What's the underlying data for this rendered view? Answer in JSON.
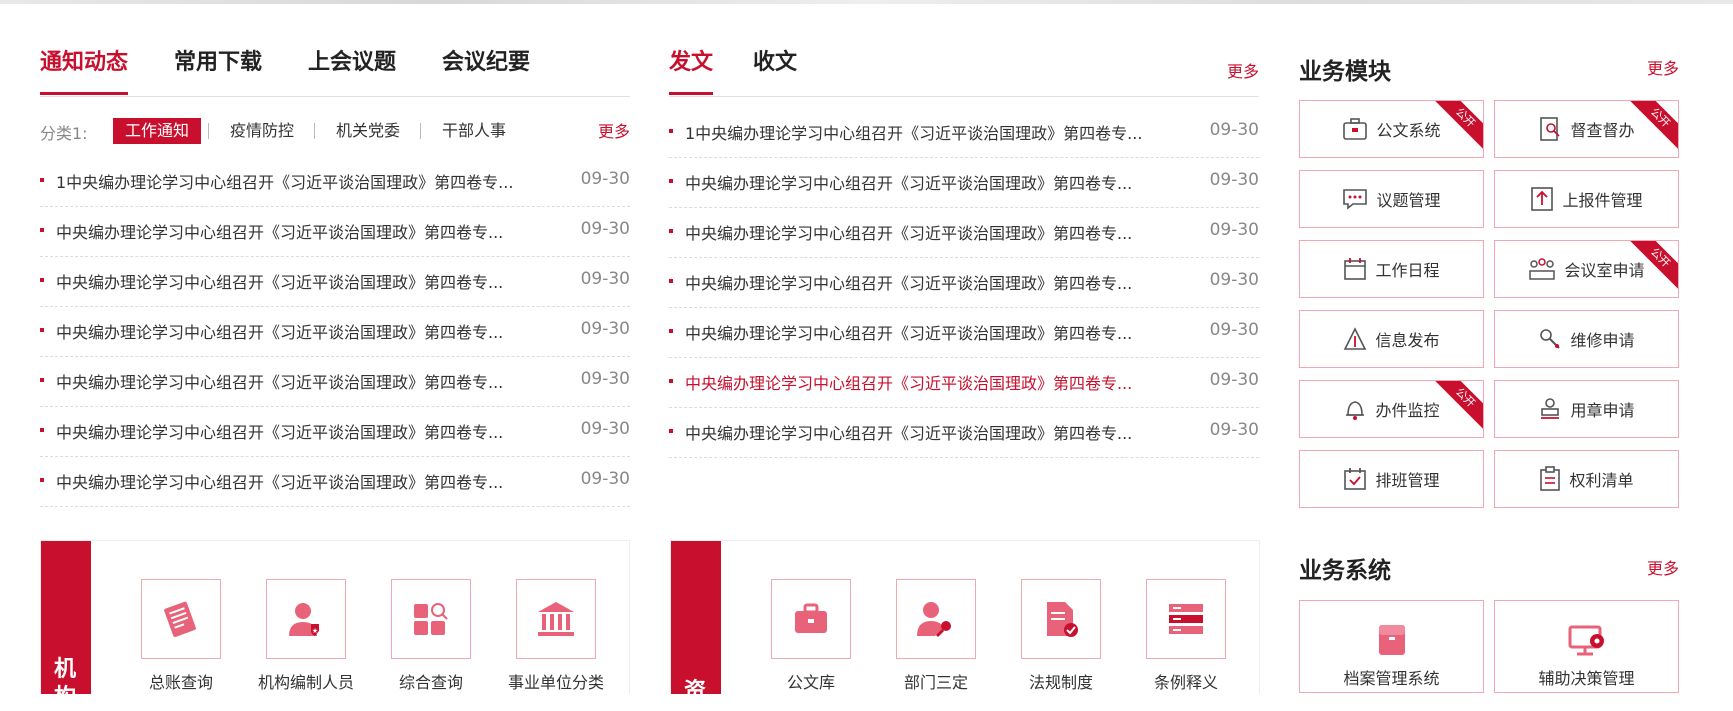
{
  "news": {
    "tabs": [
      "通知动态",
      "常用下载",
      "上会议题",
      "会议纪要"
    ],
    "filter_label": "分类1:",
    "filters": [
      "工作通知",
      "疫情防控",
      "机关党委",
      "干部人事"
    ],
    "more": "更多",
    "items": [
      {
        "title": "1中央编办理论学习中心组召开《习近平谈治国理政》第四卷专...",
        "date": "09-30"
      },
      {
        "title": "中央编办理论学习中心组召开《习近平谈治国理政》第四卷专...",
        "date": "09-30"
      },
      {
        "title": "中央编办理论学习中心组召开《习近平谈治国理政》第四卷专...",
        "date": "09-30"
      },
      {
        "title": "中央编办理论学习中心组召开《习近平谈治国理政》第四卷专...",
        "date": "09-30"
      },
      {
        "title": "中央编办理论学习中心组召开《习近平谈治国理政》第四卷专...",
        "date": "09-30"
      },
      {
        "title": "中央编办理论学习中心组召开《习近平谈治国理政》第四卷专...",
        "date": "09-30"
      },
      {
        "title": "中央编办理论学习中心组召开《习近平谈治国理政》第四卷专...",
        "date": "09-30"
      }
    ]
  },
  "docs": {
    "tabs": [
      "发文",
      "收文"
    ],
    "more": "更多",
    "items": [
      {
        "title": "1中央编办理论学习中心组召开《习近平谈治国理政》第四卷专...",
        "date": "09-30"
      },
      {
        "title": "中央编办理论学习中心组召开《习近平谈治国理政》第四卷专...",
        "date": "09-30"
      },
      {
        "title": "中央编办理论学习中心组召开《习近平谈治国理政》第四卷专...",
        "date": "09-30"
      },
      {
        "title": "中央编办理论学习中心组召开《习近平谈治国理政》第四卷专...",
        "date": "09-30"
      },
      {
        "title": "中央编办理论学习中心组召开《习近平谈治国理政》第四卷专...",
        "date": "09-30"
      },
      {
        "title": "中央编办理论学习中心组召开《习近平谈治国理政》第四卷专...",
        "date": "09-30"
      },
      {
        "title": "中央编办理论学习中心组召开《习近平谈治国理政》第四卷专...",
        "date": "09-30"
      }
    ]
  },
  "business": {
    "title": "业务模块",
    "more": "更多",
    "public_tag": "公开",
    "items": [
      {
        "label": "公文系统",
        "icon": "briefcase-icon"
      },
      {
        "label": "督查督办",
        "icon": "supervise-icon"
      },
      {
        "label": "议题管理",
        "icon": "chat-icon"
      },
      {
        "label": "上报件管理",
        "icon": "upload-icon"
      },
      {
        "label": "工作日程",
        "icon": "calendar-icon"
      },
      {
        "label": "会议室申请",
        "icon": "meeting-room-icon"
      },
      {
        "label": "信息发布",
        "icon": "broadcast-icon"
      },
      {
        "label": "维修申请",
        "icon": "wrench-icon"
      },
      {
        "label": "办件监控",
        "icon": "bell-icon"
      },
      {
        "label": "用章申请",
        "icon": "stamp-icon"
      },
      {
        "label": "排班管理",
        "icon": "schedule-check-icon"
      },
      {
        "label": "权利清单",
        "icon": "clipboard-icon"
      }
    ]
  },
  "systems": {
    "title": "业务系统",
    "more": "更多",
    "items": [
      {
        "label": "档案管理系统",
        "icon": "archive-icon"
      },
      {
        "label": "辅助决策管理",
        "icon": "monitor-gear-icon"
      }
    ]
  },
  "org_panel": {
    "band_text": [
      "机",
      "构"
    ],
    "items": [
      {
        "label": "总账查询",
        "icon": "ledger-icon"
      },
      {
        "label": "机构编制人员",
        "icon": "staff-icon"
      },
      {
        "label": "综合查询",
        "icon": "search-grid-icon"
      },
      {
        "label": "事业单位分类",
        "icon": "institution-icon"
      }
    ]
  },
  "res_panel": {
    "band_text": [
      "资"
    ],
    "items": [
      {
        "label": "公文库",
        "icon": "briefcase-icon"
      },
      {
        "label": "部门三定",
        "icon": "person-key-icon"
      },
      {
        "label": "法规制度",
        "icon": "document-check-icon"
      },
      {
        "label": "条例释义",
        "icon": "server-icon"
      }
    ]
  },
  "colors": {
    "accent": "#c8102e",
    "border": "#f2a7b2"
  }
}
